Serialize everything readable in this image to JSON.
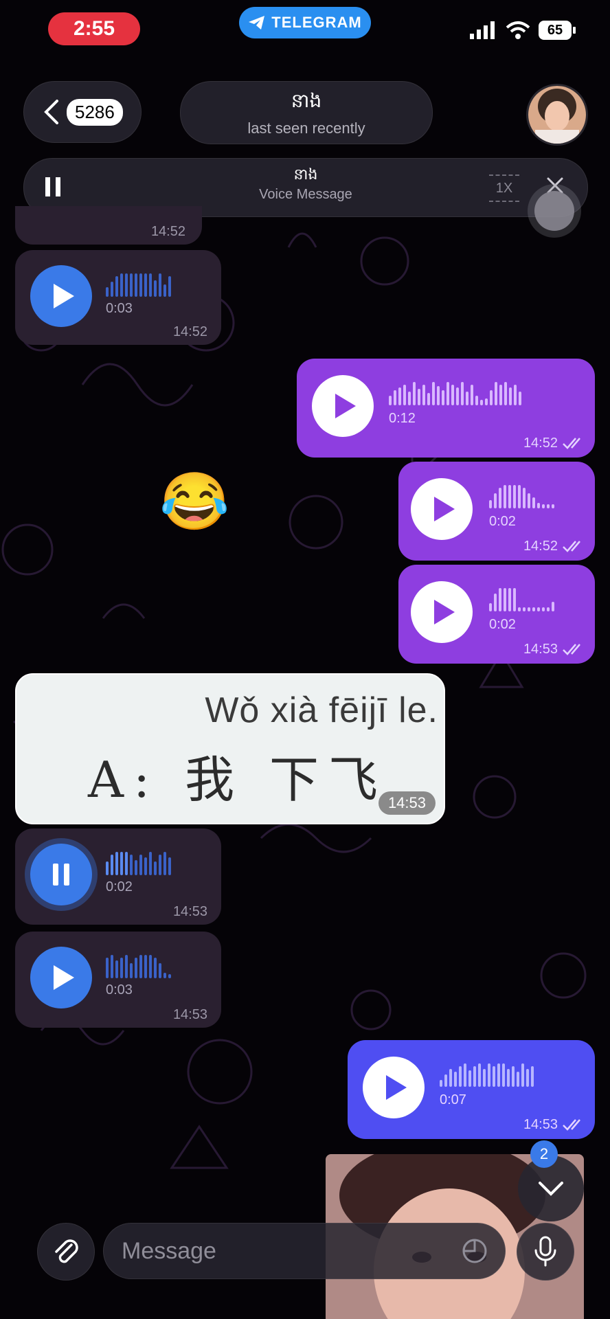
{
  "status_bar": {
    "time": "2:55",
    "app_label": "TELEGRAM",
    "battery": "65"
  },
  "header": {
    "back_count": "5286",
    "name": "នាង",
    "status": "last seen recently"
  },
  "player": {
    "title": "នាង",
    "subtitle": "Voice Message",
    "speed": "1X"
  },
  "messages": [
    {
      "time": "14:52"
    },
    {
      "duration": "0:03",
      "time": "14:52"
    },
    {
      "duration": "0:12",
      "time": "14:52"
    },
    {
      "duration": "0:02",
      "time": "14:52"
    },
    {
      "duration": "0:02",
      "time": "14:53"
    },
    {
      "time": "14:53"
    },
    {
      "duration": "0:02",
      "time": "14:53"
    },
    {
      "duration": "0:03",
      "time": "14:53"
    },
    {
      "duration": "0:07",
      "time": "14:53"
    }
  ],
  "emoji": "😂",
  "image_message": {
    "pinyin": "Wǒ xià  fēijī  le.",
    "hanzi": "A: 我 下飞机了"
  },
  "scroll_badge": "2",
  "composer": {
    "placeholder": "Message"
  },
  "colors": {
    "accent": "#3a7ae8",
    "outgoing": "#8e3ee0",
    "outgoing_alt": "#4f4ef2",
    "recording": "#e5323f"
  }
}
